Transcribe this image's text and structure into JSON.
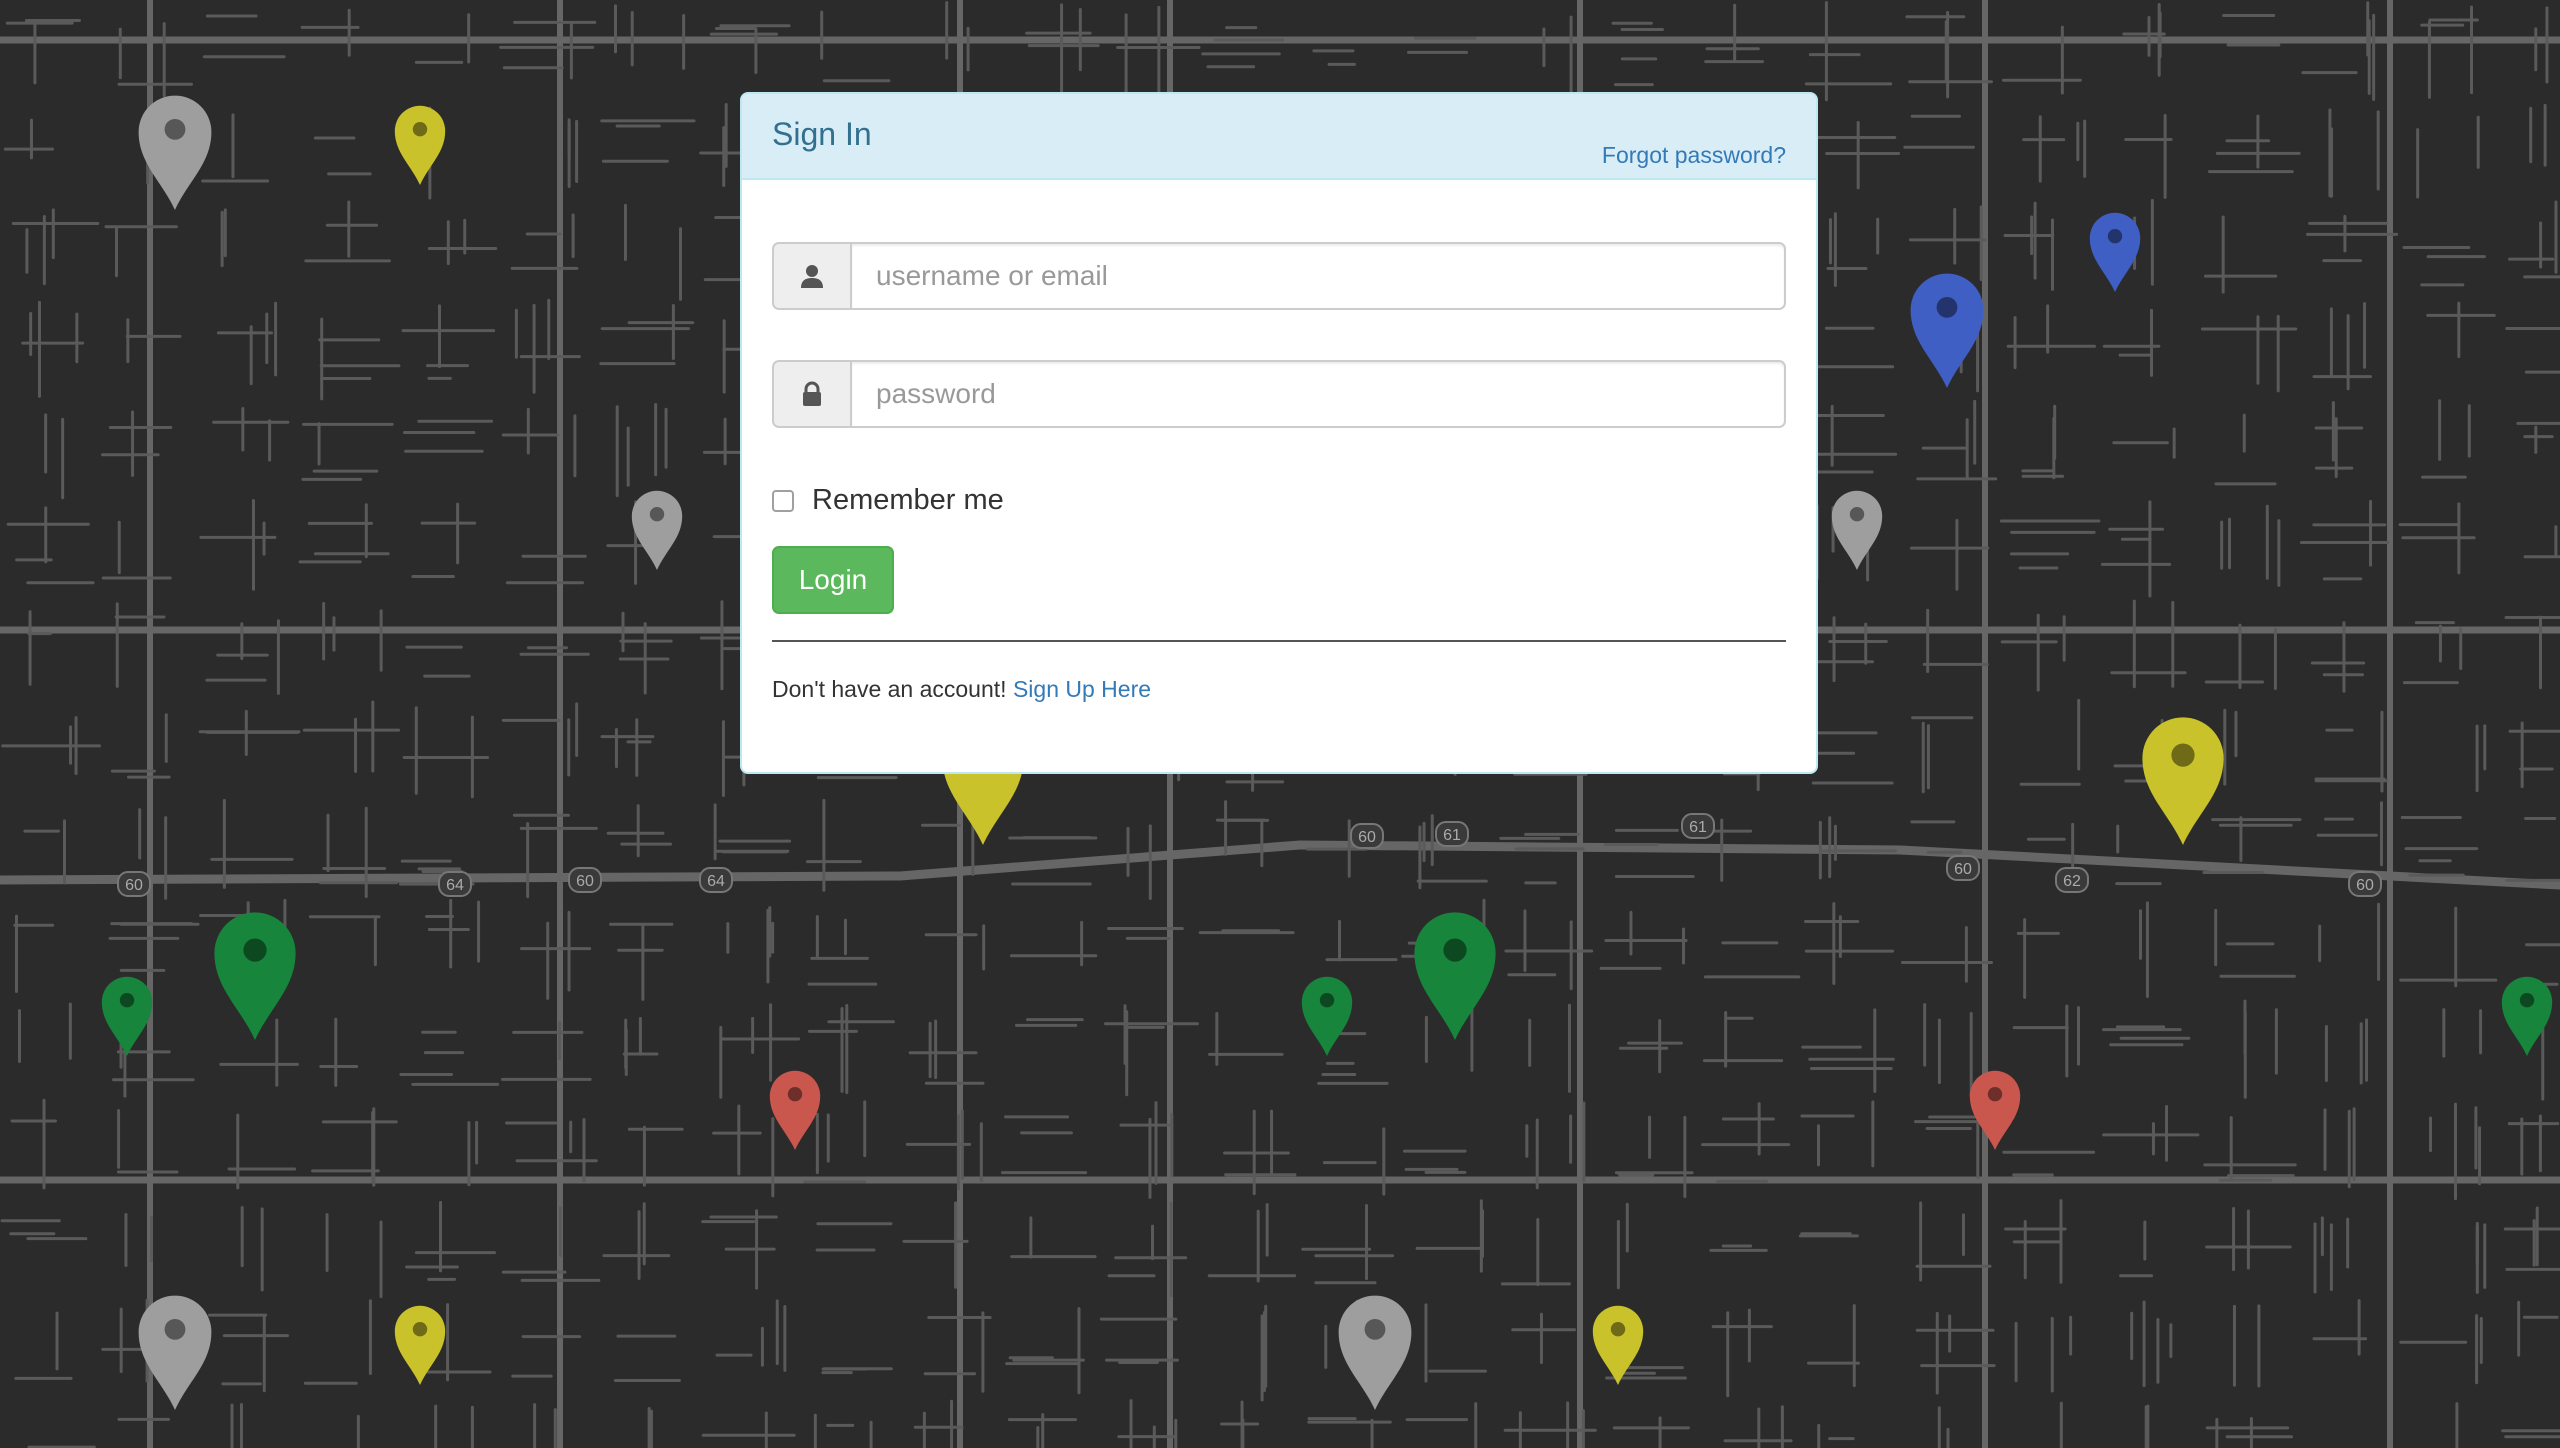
{
  "map": {
    "background_color": "#2b2b2b",
    "road_color": "#5a5a5a",
    "major_road_color": "#666666",
    "highway_shields": [
      "60",
      "64",
      "60",
      "64",
      "60",
      "61",
      "61",
      "60",
      "62",
      "60"
    ],
    "marker_colors": {
      "gray": "#9e9e9e",
      "yellow": "#c9c22a",
      "blue": "#3f5fc4",
      "green": "#17853c",
      "red": "#c9574e"
    }
  },
  "login": {
    "title": "Sign In",
    "forgot_password": "Forgot password?",
    "username": {
      "icon": "user-icon",
      "value": "",
      "placeholder": "username or email"
    },
    "password": {
      "icon": "lock-icon",
      "value": "",
      "placeholder": "password"
    },
    "remember_me": {
      "label": "Remember me",
      "checked": false
    },
    "login_button": "Login",
    "signup_prompt": "Don't have an account!",
    "signup_link": "Sign Up Here",
    "colors": {
      "heading_bg": "#d9edf7",
      "heading_text": "#31708f",
      "link": "#337ab7",
      "button": "#5cb85c"
    }
  }
}
